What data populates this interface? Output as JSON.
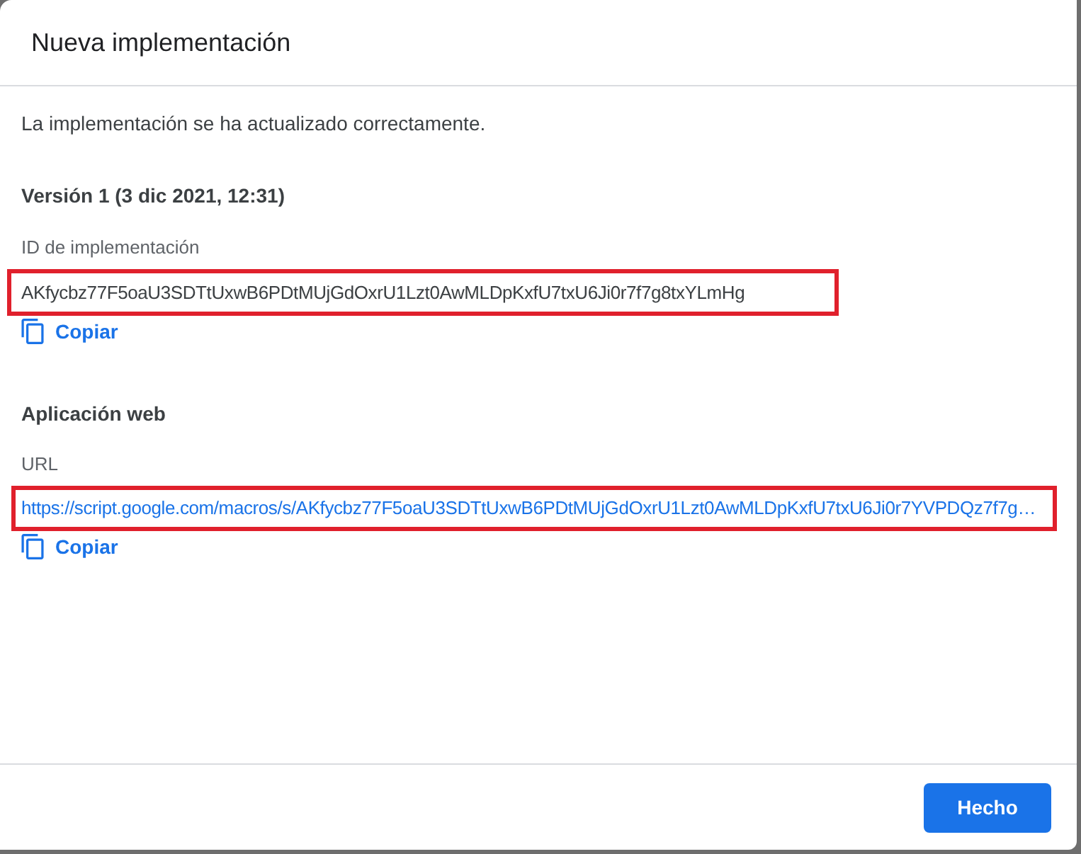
{
  "dialog": {
    "title": "Nueva implementación"
  },
  "message": "La implementación se ha actualizado correctamente.",
  "sections": [
    {
      "heading": "Versión 1 (3 dic 2021, 12:31)",
      "fields": [
        {
          "kind": "text",
          "label": "ID de implementación",
          "value": "AKfycbz77F5oaU3SDTtUxwB6PDtMUjGdOxrU1Lzt0AwMLDpKxfU7txU6Ji0r7f7g8txYLmHg",
          "highlighted": true,
          "copy_label": "Copiar"
        }
      ]
    },
    {
      "heading": "Aplicación web",
      "fields": [
        {
          "kind": "link",
          "label": "URL",
          "value": "https://script.google.com/macros/s/AKfycbz77F5oaU3SDTtUxwB6PDtMUjGdOxrU1Lzt0AwMLDpKxfU7txU6Ji0r7YVPDQz7f7g…",
          "highlighted": true,
          "copy_label": "Copiar"
        }
      ]
    }
  ],
  "footer": {
    "buttons": [
      {
        "kind": "primary",
        "label": "Hecho"
      }
    ]
  }
}
